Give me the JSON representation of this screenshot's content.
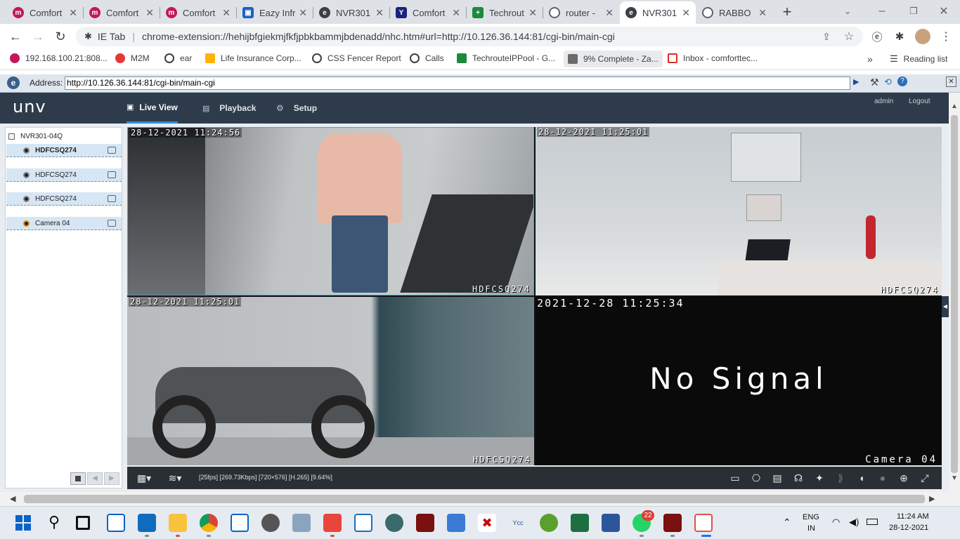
{
  "tabs": [
    {
      "title": "Comfort",
      "color": "#c2185b"
    },
    {
      "title": "Comfort",
      "color": "#c2185b"
    },
    {
      "title": "Comfort",
      "color": "#c2185b"
    },
    {
      "title": "Eazy Infr",
      "color": "#1565c0"
    },
    {
      "title": "NVR301",
      "color": "#3c4043"
    },
    {
      "title": "Comfort",
      "color": "#1a237e"
    },
    {
      "title": "Techrout",
      "color": "#1b8a3a"
    },
    {
      "title": "router -",
      "color": "#5f6368"
    },
    {
      "title": "NVR301",
      "color": "#3c4043"
    },
    {
      "title": "RABBO",
      "color": "#5f6368"
    }
  ],
  "active_tab_index": 8,
  "omnibox": {
    "prefix": "IE Tab",
    "url": "chrome-extension://hehijbfgiekmjfkfjpbkbammjbdenadd/nhc.htm#url=http://10.126.36.144:81/cgi-bin/main-cgi"
  },
  "bookmarks": [
    {
      "label": "192.168.100.21:808...",
      "color": "#c2185b"
    },
    {
      "label": "M2M",
      "color": "#e53935"
    },
    {
      "label": "ear",
      "color": "#3c4043"
    },
    {
      "label": "Life Insurance Corp...",
      "color": "#ffb300"
    },
    {
      "label": "CSS Fencer Report",
      "color": "#3c4043"
    },
    {
      "label": "Calls",
      "color": "#3c4043"
    },
    {
      "label": "TechrouteIPPool - G...",
      "color": "#1b8a3a"
    },
    {
      "label": "9% Complete - Za...",
      "color": "#6a6a6a"
    },
    {
      "label": "Inbox - comforttec...",
      "color": "#d93025"
    }
  ],
  "reading_list": "Reading list",
  "iebar": {
    "label": "Address:",
    "url": "http://10.126.36.144:81/cgi-bin/main-cgi"
  },
  "nvr": {
    "logo": "unv",
    "nav": [
      "Live View",
      "Playback",
      "Setup"
    ],
    "user": "admin",
    "logout": "Logout",
    "device": "NVR301-04Q",
    "cameras": [
      "HDFCSQ274",
      "HDFCSQ274",
      "HDFCSQ274",
      "Camera 04"
    ],
    "panes": [
      {
        "timestamp": "28-12-2021 11:24:56",
        "name": "HDFCSQ274"
      },
      {
        "timestamp": "28-12-2021 11:25:01",
        "name": "HDFCSQ274"
      },
      {
        "timestamp": "28-12-2021 11:25:01",
        "name": "HDFCSQ274"
      },
      {
        "timestamp": "2021-12-28 11:25:34",
        "name": "Camera 04",
        "message": "No Signal"
      }
    ],
    "stream_info": "[25fps] [269.73Kbps] [720×576] [H.265] [9.64%]"
  },
  "taskbar": {
    "lang1": "ENG",
    "lang2": "IN",
    "time": "11:24 AM",
    "date": "28-12-2021",
    "whatsapp_badge": "22"
  }
}
